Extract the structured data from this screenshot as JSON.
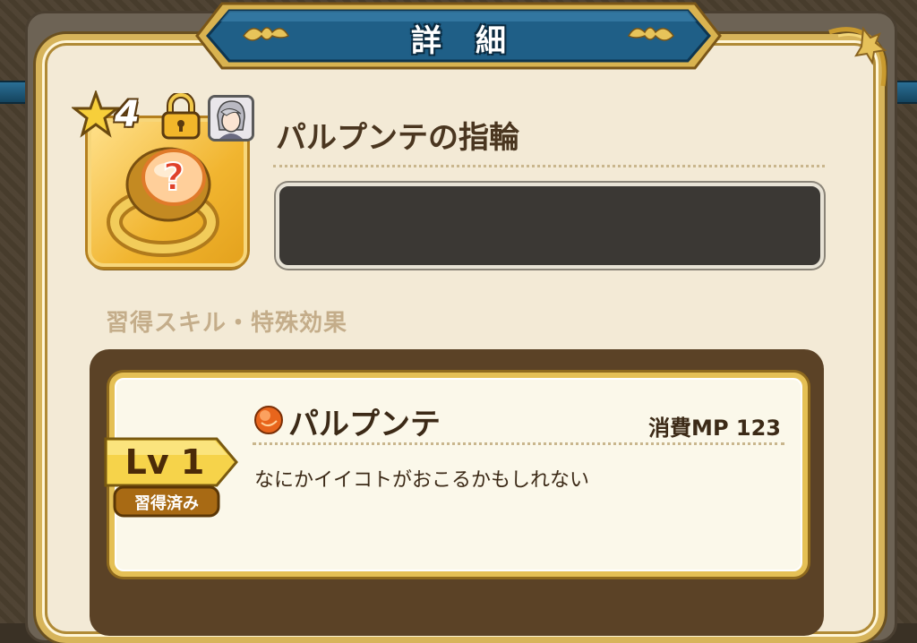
{
  "header": {
    "title": "詳細"
  },
  "item": {
    "rarity_stars": "4",
    "name": "パルプンテの指輪",
    "icon": "ring-question-icon",
    "locked_icon": "lock-icon",
    "equipped_character_icon": "character-portrait-icon"
  },
  "section": {
    "label": "習得スキル・特殊効果"
  },
  "skill": {
    "level_label": "Lv 1",
    "status_label": "習得済み",
    "name": "パルプンテ",
    "mp_label": "消費MP 123",
    "description": "なにかイイコトがおこるかもしれない",
    "orb_icon": "orange-orb-icon"
  },
  "colors": {
    "accent_gold": "#e5c055",
    "banner_blue": "#1f5f87",
    "panel_bg": "#f3ead6",
    "text_dark": "#3c2a17"
  }
}
